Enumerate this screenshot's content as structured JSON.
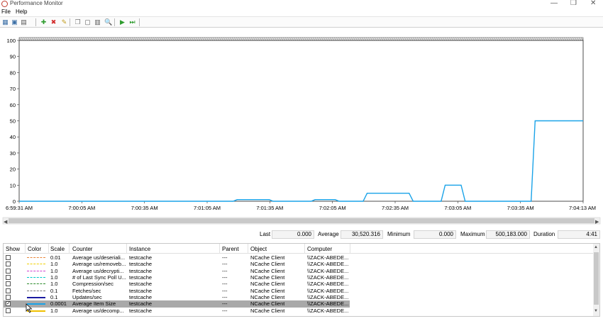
{
  "window": {
    "title": "Performance Monitor"
  },
  "menu": [
    {
      "label": "File"
    },
    {
      "label": "Help"
    }
  ],
  "toolbar": [
    {
      "name": "view-graph-icon",
      "glyph": "▦",
      "color": "#3a6ea5"
    },
    {
      "name": "change-graph-type-icon",
      "glyph": "▣",
      "color": "#3a6ea5"
    },
    {
      "name": "change-graph-type-dropdown-icon",
      "glyph": "▤",
      "color": "#555555"
    },
    {
      "name": "add-counter-icon",
      "glyph": "✚",
      "color": "#2e9c2e"
    },
    {
      "name": "delete-counter-icon",
      "glyph": "✖",
      "color": "#d22b2b"
    },
    {
      "name": "highlight-icon",
      "glyph": "✎",
      "color": "#c29b1c"
    },
    {
      "name": "copy-properties-icon",
      "glyph": "❐",
      "color": "#777777"
    },
    {
      "name": "paste-counter-list-icon",
      "glyph": "▢",
      "color": "#555555"
    },
    {
      "name": "properties-icon",
      "glyph": "▥",
      "color": "#555555"
    },
    {
      "name": "zoom-icon",
      "glyph": "🔍",
      "color": "#3a6ea5"
    },
    {
      "name": "unfreeze-display-icon",
      "glyph": "▶",
      "color": "#2e9c2e"
    },
    {
      "name": "update-data-icon",
      "glyph": "⏭",
      "color": "#2e9c2e"
    }
  ],
  "chart_data": {
    "type": "line",
    "ylim": [
      0,
      100
    ],
    "yticks": [
      0,
      10,
      20,
      30,
      40,
      50,
      60,
      70,
      80,
      90,
      100
    ],
    "xticks": [
      "6:59:31 AM",
      "7:00:05 AM",
      "7:00:35 AM",
      "7:01:05 AM",
      "7:01:35 AM",
      "7:02:05 AM",
      "7:02:35 AM",
      "7:03:05 AM",
      "7:03:35 AM",
      "7:04:13 AM"
    ],
    "grid": true,
    "series": [
      {
        "color": "#1aa3e8",
        "t": [
          0,
          107,
          109,
          125,
          127,
          146,
          148,
          158,
          160,
          172,
          174,
          195,
          197,
          211,
          213,
          221,
          223,
          256,
          258,
          282
        ],
        "v": [
          0,
          0,
          1,
          1,
          0,
          0,
          1,
          1,
          0,
          0,
          5,
          5,
          0,
          0,
          10,
          10,
          0,
          0,
          50,
          50
        ]
      }
    ]
  },
  "stats": {
    "last_label": "Last",
    "last_value": "0.000",
    "average_label": "Average",
    "average_value": "30,520.316",
    "minimum_label": "Minimum",
    "minimum_value": "0.000",
    "maximum_label": "Maximum",
    "maximum_value": "500,183.000",
    "duration_label": "Duration",
    "duration_value": "4:41"
  },
  "columns": [
    "Show",
    "Color",
    "Scale",
    "Counter",
    "Instance",
    "Parent",
    "Object",
    "Computer"
  ],
  "rows": [
    {
      "show": false,
      "color": "#e8873a",
      "dash": "2,1",
      "scale": "0.01",
      "counter": "Average us/deseriali...",
      "instance": "testcache",
      "parent": "---",
      "object": "NCache Client",
      "computer": "\\\\ZACK-ABEDE...",
      "selected": false
    },
    {
      "show": false,
      "color": "#f0d000",
      "dash": "2,1",
      "scale": "1.0",
      "counter": "Average us/removeb...",
      "instance": "testcache",
      "parent": "---",
      "object": "NCache Client",
      "computer": "\\\\ZACK-ABEDE...",
      "selected": false
    },
    {
      "show": false,
      "color": "#d040d0",
      "dash": "2,1",
      "scale": "1.0",
      "counter": "Average us/decrypti...",
      "instance": "testcache",
      "parent": "---",
      "object": "NCache Client",
      "computer": "\\\\ZACK-ABEDE...",
      "selected": false
    },
    {
      "show": false,
      "color": "#00c8c8",
      "dash": "2,1",
      "scale": "1.0",
      "counter": "# of Last Sync Poll U...",
      "instance": "testcache",
      "parent": "---",
      "object": "NCache Client",
      "computer": "\\\\ZACK-ABEDE...",
      "selected": false
    },
    {
      "show": false,
      "color": "#2a8a2a",
      "dash": "2,1",
      "scale": "1.0",
      "counter": "Compression/sec",
      "instance": "testcache",
      "parent": "---",
      "object": "NCache Client",
      "computer": "\\\\ZACK-ABEDE...",
      "selected": false
    },
    {
      "show": false,
      "color": "#777777",
      "dash": "2,1",
      "scale": "0.1",
      "counter": "Fetches/sec",
      "instance": "testcache",
      "parent": "---",
      "object": "NCache Client",
      "computer": "\\\\ZACK-ABEDE...",
      "selected": false
    },
    {
      "show": false,
      "color": "#1a1aa0",
      "dash": "",
      "scale": "0.1",
      "counter": "Updates/sec",
      "instance": "testcache",
      "parent": "---",
      "object": "NCache Client",
      "computer": "\\\\ZACK-ABEDE...",
      "selected": false
    },
    {
      "show": true,
      "color": "#1aa3e8",
      "dash": "",
      "scale": "0.0001",
      "counter": "Average Item Size",
      "instance": "testcache",
      "parent": "---",
      "object": "NCache Client",
      "computer": "\\\\ZACK-ABEDE...",
      "selected": true
    },
    {
      "show": false,
      "color": "#f0c000",
      "dash": "",
      "scale": "1.0",
      "counter": "Average us/decomp...",
      "instance": "testcache",
      "parent": "---",
      "object": "NCache Client",
      "computer": "\\\\ZACK-ABEDE...",
      "selected": false
    }
  ]
}
